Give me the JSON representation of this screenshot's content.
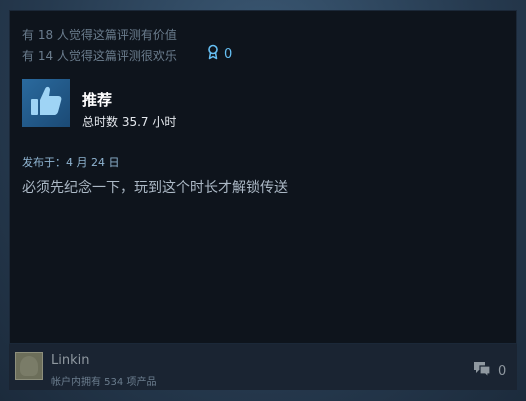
{
  "review": {
    "helpful_line": "有 18 人觉得这篇评测有价值",
    "funny_line": "有 14 人觉得这篇评测很欢乐",
    "award_count": "0",
    "recommend_label": "推荐",
    "hours_on_record": "总时数 35.7 小时",
    "posted_date": "发布于：4 月 24 日",
    "text": "必须先纪念一下，玩到这个时长才解锁传送"
  },
  "author": {
    "name": "Linkin",
    "products_owned": "帐户内拥有 534 项产品"
  },
  "comments": {
    "count": "0"
  },
  "colors": {
    "accent": "#66c0f4",
    "card_bg": "#0e141c",
    "footer_bg": "#1a2432"
  },
  "icons": [
    "award-icon",
    "thumbs-up-icon",
    "comment-icon"
  ]
}
